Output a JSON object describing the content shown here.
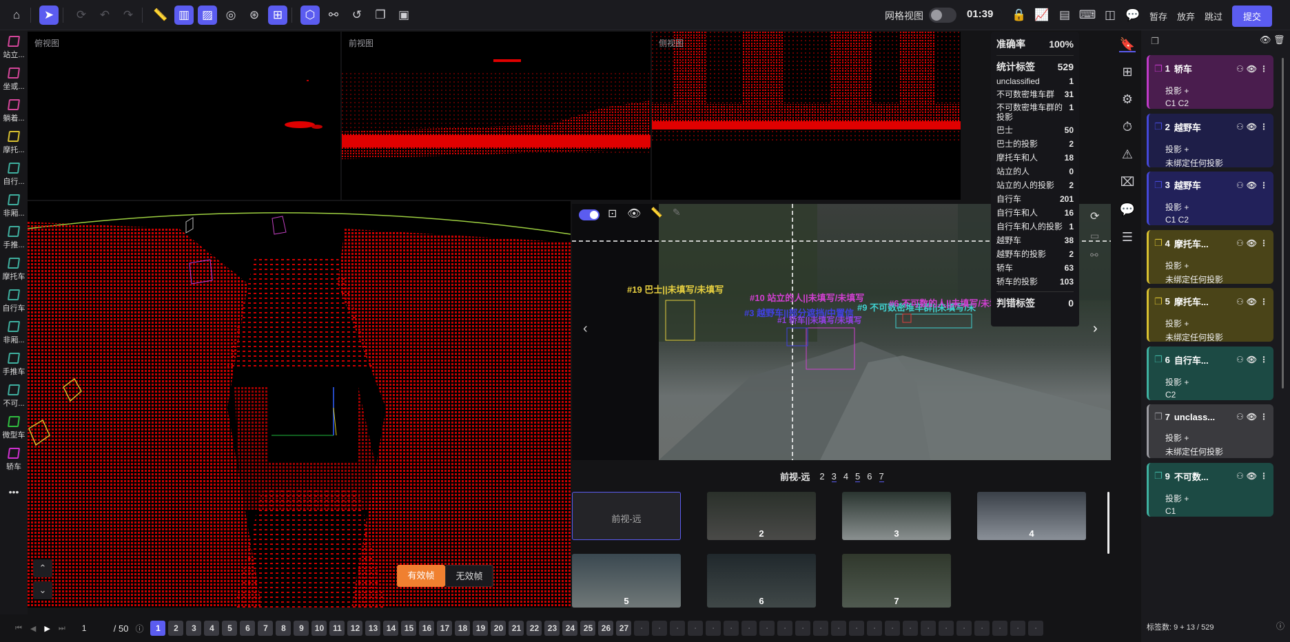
{
  "toolbar": {
    "grid_view_label": "网格视图",
    "timer": "01:39",
    "actions": {
      "pause": "暂存",
      "discard": "放弃",
      "skip": "跳过",
      "submit": "提交"
    }
  },
  "left_classes": [
    {
      "label": "站立...",
      "color": "#d4469a"
    },
    {
      "label": "坐或...",
      "color": "#d4469a"
    },
    {
      "label": "躺着...",
      "color": "#d4469a"
    },
    {
      "label": "摩托...",
      "color": "#d8c030"
    },
    {
      "label": "自行...",
      "color": "#3fb0a0"
    },
    {
      "label": "非厢...",
      "color": "#3fb0a0"
    },
    {
      "label": "手推...",
      "color": "#3fb0a0"
    },
    {
      "label": "摩托车",
      "color": "#3fb0a0"
    },
    {
      "label": "自行车",
      "color": "#3fb0a0"
    },
    {
      "label": "非厢...",
      "color": "#3fb0a0"
    },
    {
      "label": "手推车",
      "color": "#3fb0a0"
    },
    {
      "label": "不可...",
      "color": "#3fb0a0"
    },
    {
      "label": "微型车",
      "color": "#30c040"
    },
    {
      "label": "轿车",
      "color": "#d030d0"
    }
  ],
  "left_more": "•••",
  "views": {
    "top": "俯视图",
    "front": "前视图",
    "side": "侧视图"
  },
  "stats": {
    "accuracy_label": "准确率",
    "accuracy": "100%",
    "total_label": "统计标签",
    "total": "529",
    "rows": [
      {
        "label": "unclassified",
        "value": "1"
      },
      {
        "label": "不可数密堆车群",
        "value": "31"
      },
      {
        "label": "不可数密堆车群的投影",
        "value": "1"
      },
      {
        "label": "巴士",
        "value": "50"
      },
      {
        "label": "巴士的投影",
        "value": "2"
      },
      {
        "label": "摩托车和人",
        "value": "18"
      },
      {
        "label": "站立的人",
        "value": "0"
      },
      {
        "label": "站立的人的投影",
        "value": "2"
      },
      {
        "label": "自行车",
        "value": "201"
      },
      {
        "label": "自行车和人",
        "value": "16"
      },
      {
        "label": "自行车和人的投影",
        "value": "1"
      },
      {
        "label": "越野车",
        "value": "38"
      },
      {
        "label": "越野车的投影",
        "value": "2"
      },
      {
        "label": "轿车",
        "value": "63"
      },
      {
        "label": "轿车的投影",
        "value": "103"
      }
    ],
    "error_label": "判错标签",
    "error": "0"
  },
  "camera": {
    "labels": [
      {
        "text": "#19 巴士||未填写/未填写",
        "color": "#e8d040"
      },
      {
        "text": "#10 站立的人||未填写/未填写",
        "color": "#d040d0"
      },
      {
        "text": "#3 越野车||部分遮挡/中置信",
        "color": "#4040e0"
      },
      {
        "text": "#9 不可数密堆车群||未填写/未",
        "color": "#40d0d0"
      },
      {
        "text": "#6 不可数的人||未填写/未填写",
        "color": "#d040d0"
      },
      {
        "text": "#1 轿车||未填写/未填写",
        "color": "#9040e0"
      }
    ],
    "tab_label": "前视-远",
    "tab_numbers": [
      "2",
      "3",
      "4",
      "5",
      "6",
      "7"
    ]
  },
  "thumbs": [
    {
      "label": "前视-远"
    },
    {
      "label": "2"
    },
    {
      "label": "3"
    },
    {
      "label": "4"
    },
    {
      "label": "5"
    },
    {
      "label": "6"
    },
    {
      "label": "7"
    }
  ],
  "frame_buttons": {
    "valid": "有效帧",
    "invalid": "无效帧"
  },
  "objects": [
    {
      "num": "1",
      "name": "轿车",
      "p1": "投影 +",
      "p2": "C1  C2",
      "bg": "#4a1d4e",
      "accent": "#c03ac8"
    },
    {
      "num": "2",
      "name": "越野车",
      "p1": "投影 +",
      "p2": "未绑定任何投影",
      "bg": "#1e1e48",
      "accent": "#4448d8"
    },
    {
      "num": "3",
      "name": "越野车",
      "p1": "投影 +",
      "p2": "C1  C2",
      "bg": "#22215a",
      "accent": "#4448d8"
    },
    {
      "num": "4",
      "name": "摩托车...",
      "p1": "投影 +",
      "p2": "未绑定任何投影",
      "bg": "#4a4418",
      "accent": "#d8c030"
    },
    {
      "num": "5",
      "name": "摩托车...",
      "p1": "投影 +",
      "p2": "未绑定任何投影",
      "bg": "#4a4418",
      "accent": "#d8c030"
    },
    {
      "num": "6",
      "name": "自行车...",
      "p1": "投影 +",
      "p2": "C2",
      "bg": "#1c4a44",
      "accent": "#3fb0a0"
    },
    {
      "num": "7",
      "name": "unclass...",
      "p1": "投影 +",
      "p2": "未绑定任何投影",
      "bg": "#3a3a3e",
      "accent": "#9a9aa0"
    },
    {
      "num": "9",
      "name": "不可数...",
      "p1": "投影 +",
      "p2": "C1",
      "bg": "#1c4a44",
      "accent": "#3fb0a0"
    }
  ],
  "label_count": "标签数:  9 + 13 / 529",
  "pagination": {
    "current": "1",
    "total": "/ 50",
    "pages": [
      "1",
      "2",
      "3",
      "4",
      "5",
      "6",
      "7",
      "8",
      "9",
      "10",
      "11",
      "12",
      "13",
      "14",
      "15",
      "16",
      "17",
      "18",
      "19",
      "20",
      "21",
      "22",
      "23",
      "24",
      "25",
      "26",
      "27"
    ]
  }
}
